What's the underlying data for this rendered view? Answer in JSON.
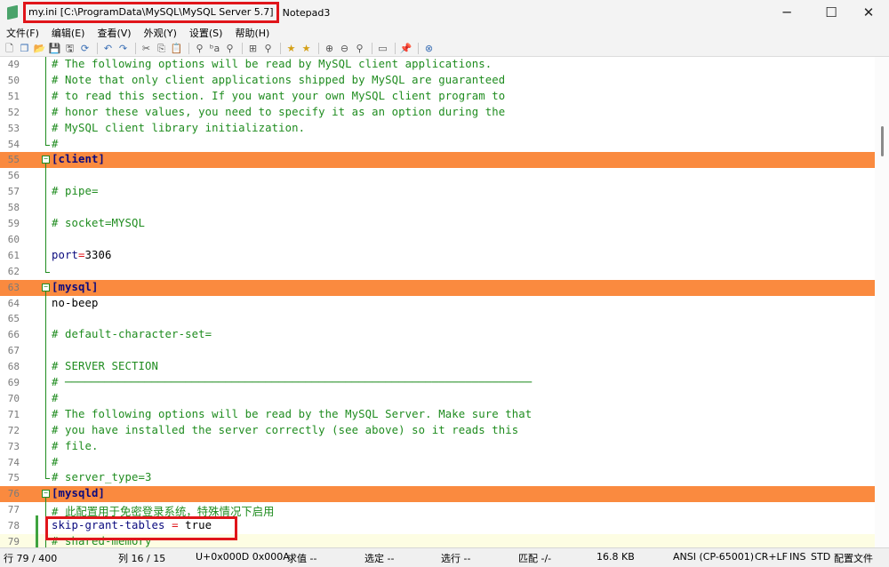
{
  "window": {
    "file_title": "my.ini [C:\\ProgramData\\MySQL\\MySQL Server 5.7]",
    "app_name": "Notepad3",
    "controls": {
      "minimize": "─",
      "maximize": "☐",
      "close": "✕"
    }
  },
  "menu": [
    "文件(F)",
    "编辑(E)",
    "查看(V)",
    "外观(Y)",
    "设置(S)",
    "帮助(H)"
  ],
  "toolbar": {
    "buttons": [
      "new",
      "open-window",
      "open",
      "save",
      "save-as",
      "reload",
      "undo",
      "redo",
      "cut",
      "copy",
      "paste",
      "find",
      "replace",
      "goto",
      "word-wrap",
      "zoom",
      "favorites",
      "add-favorite",
      "zoom-in",
      "zoom-out",
      "zoom-reset",
      "screen",
      "pin",
      "exit"
    ],
    "glyphs": [
      "🗋",
      "❐",
      "📂",
      "💾",
      "🖫",
      "⟳",
      "↶",
      "↷",
      "✂",
      "⎘",
      "📋",
      "⚲",
      "ᵇa",
      "⚲",
      "⊞",
      "⚲",
      "★",
      "★",
      "⊕",
      "⊖",
      "⚲",
      "▭",
      "📌",
      "⊗"
    ]
  },
  "editor": {
    "lines": [
      {
        "n": "49",
        "type": "comment",
        "text": "# The following options will be read by MySQL client applications."
      },
      {
        "n": "50",
        "type": "comment",
        "text": "# Note that only client applications shipped by MySQL are guaranteed"
      },
      {
        "n": "51",
        "type": "comment",
        "text": "# to read this section. If you want your own MySQL client program to"
      },
      {
        "n": "52",
        "type": "comment",
        "text": "# honor these values, you need to specify it as an option during the"
      },
      {
        "n": "53",
        "type": "comment",
        "text": "# MySQL client library initialization."
      },
      {
        "n": "54",
        "type": "comment",
        "text": "#"
      },
      {
        "n": "55",
        "type": "section",
        "text": "[client]"
      },
      {
        "n": "56",
        "type": "blank",
        "text": ""
      },
      {
        "n": "57",
        "type": "comment",
        "text": "# pipe="
      },
      {
        "n": "58",
        "type": "blank",
        "text": ""
      },
      {
        "n": "59",
        "type": "comment",
        "text": "# socket=MYSQL"
      },
      {
        "n": "60",
        "type": "blank",
        "text": ""
      },
      {
        "n": "61",
        "type": "kv",
        "key": "port",
        "op": "=",
        "val": "3306"
      },
      {
        "n": "62",
        "type": "blank",
        "text": ""
      },
      {
        "n": "63",
        "type": "section",
        "text": "[mysql]"
      },
      {
        "n": "64",
        "type": "plain",
        "text": "no-beep"
      },
      {
        "n": "65",
        "type": "blank",
        "text": ""
      },
      {
        "n": "66",
        "type": "comment",
        "text": "# default-character-set="
      },
      {
        "n": "67",
        "type": "blank",
        "text": ""
      },
      {
        "n": "68",
        "type": "comment",
        "text": "# SERVER SECTION"
      },
      {
        "n": "69",
        "type": "comment",
        "text": "# ──────────────────────────────────────────────────────────────────────"
      },
      {
        "n": "70",
        "type": "comment",
        "text": "#"
      },
      {
        "n": "71",
        "type": "comment",
        "text": "# The following options will be read by the MySQL Server. Make sure that"
      },
      {
        "n": "72",
        "type": "comment",
        "text": "# you have installed the server correctly (see above) so it reads this"
      },
      {
        "n": "73",
        "type": "comment",
        "text": "# file."
      },
      {
        "n": "74",
        "type": "comment",
        "text": "#"
      },
      {
        "n": "75",
        "type": "comment",
        "text": "# server_type=3"
      },
      {
        "n": "76",
        "type": "section",
        "text": "[mysqld]"
      },
      {
        "n": "77",
        "type": "comment",
        "text": "# 此配置用于免密登录系统，特殊情况下启用"
      },
      {
        "n": "78",
        "type": "kv",
        "key": "skip-grant-tables",
        "op": " = ",
        "val": "true"
      },
      {
        "n": "79",
        "type": "comment",
        "text": "# shared-memory"
      }
    ]
  },
  "status": {
    "line": "行 79 / 400",
    "col": "列 16 / 15",
    "char": "U+0x000D 0x000A",
    "sum": "求值 --",
    "sel": "选定 --",
    "sel_lines": "选行 --",
    "match": "匹配 -/-",
    "size": "16.8 KB",
    "encoding": "ANSI (CP-65001)",
    "eol": "CR+LF",
    "ins": "INS",
    "std": "STD",
    "mode": "配置文件"
  }
}
